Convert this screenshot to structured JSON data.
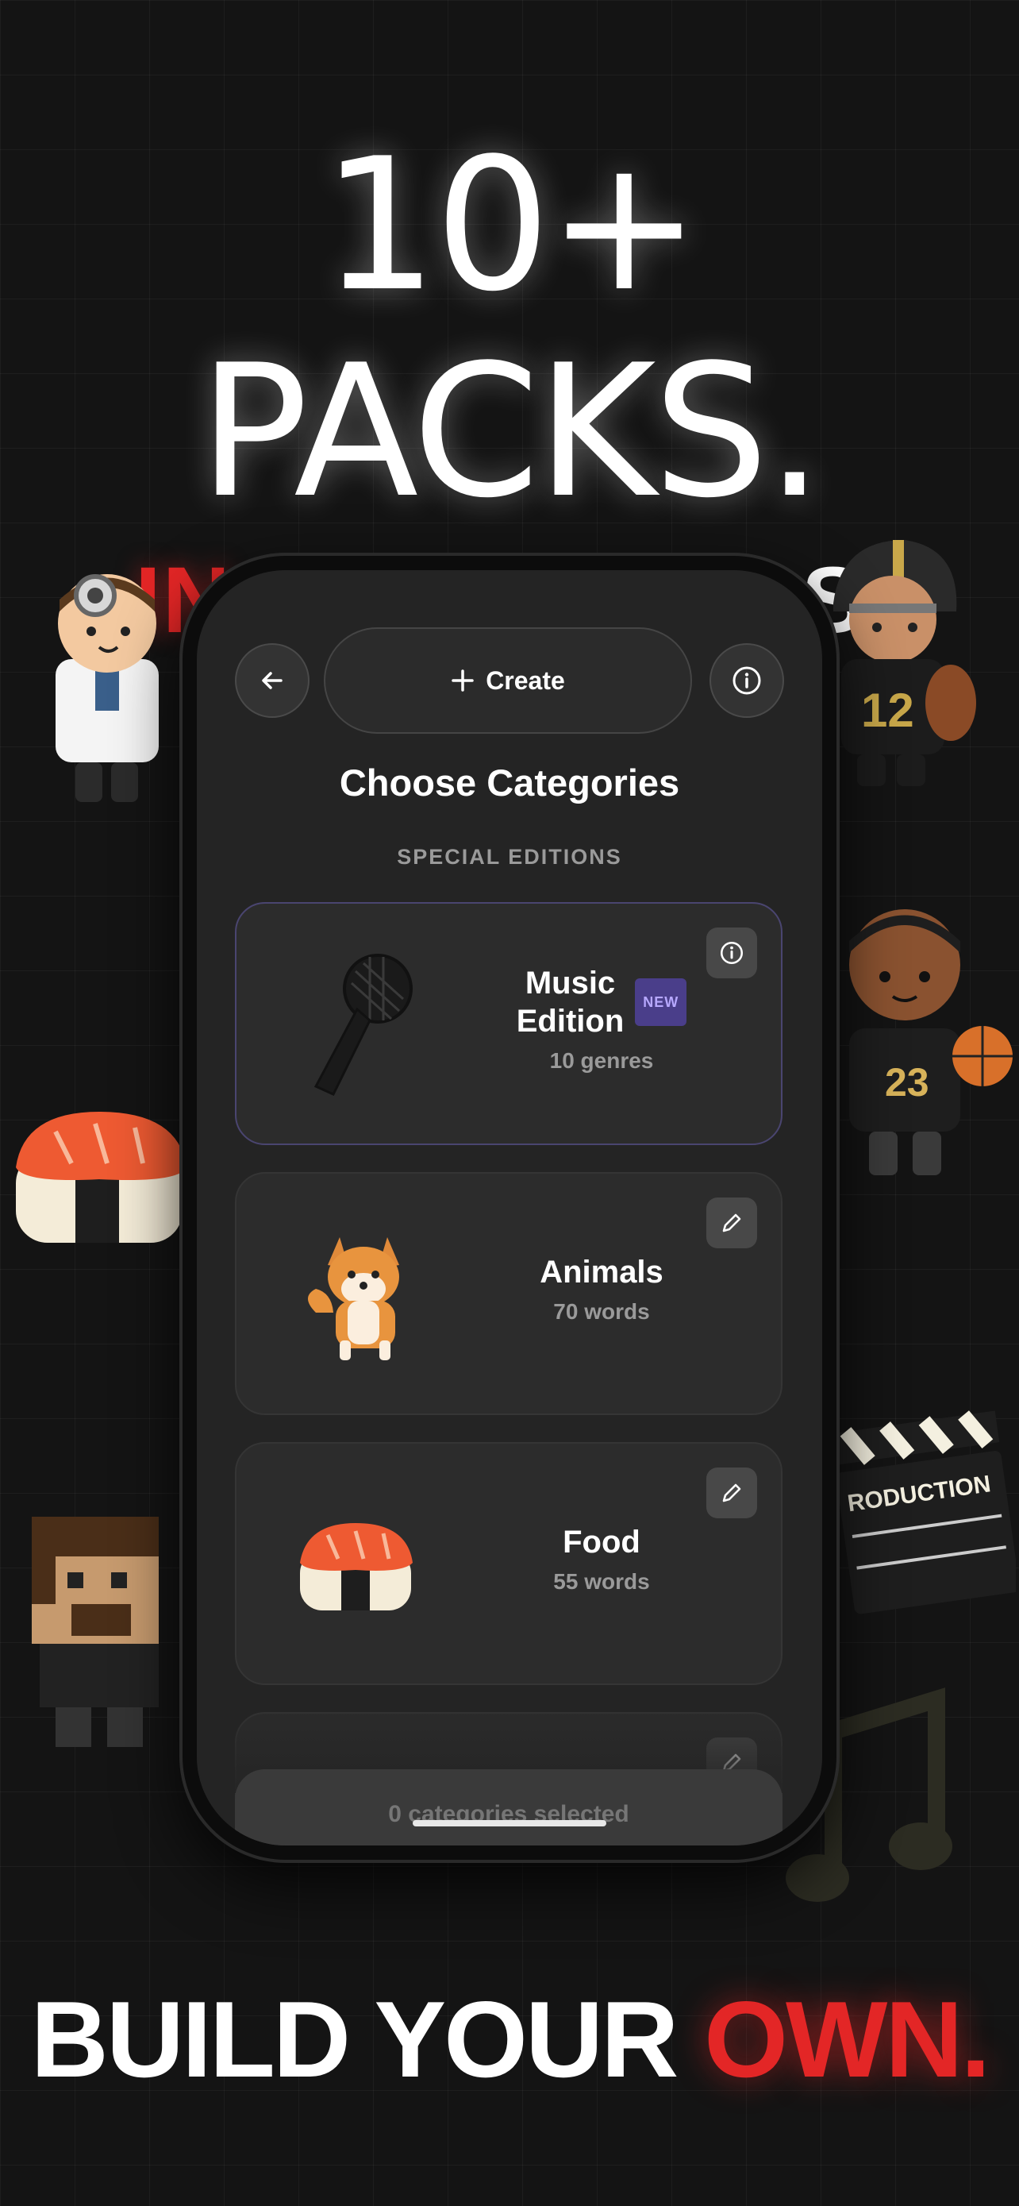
{
  "hero": {
    "line1": "10+",
    "line2": "PACKS.",
    "peek_left": "IN",
    "peek_right": "S."
  },
  "footer": {
    "part1": "BUILD YOUR ",
    "part2": "OWN."
  },
  "app": {
    "create_label": "Create",
    "title": "Choose Categories",
    "section_label": "SPECIAL EDITIONS",
    "cards": [
      {
        "name": "Music\nEdition",
        "name_line1": "Music",
        "name_line2": "Edition",
        "badge": "NEW",
        "sub": "10 genres",
        "corner_icon": "info-icon",
        "art_icon": "microphone-icon"
      },
      {
        "name": "Animals",
        "sub": "70 words",
        "corner_icon": "pencil-icon",
        "art_icon": "shiba-dog-icon"
      },
      {
        "name": "Food",
        "sub": "55 words",
        "corner_icon": "pencil-icon",
        "art_icon": "salmon-sushi-icon"
      },
      {
        "corner_icon": "pencil-icon"
      }
    ],
    "selected_status": "0 categories selected"
  },
  "colors": {
    "accent_red": "#e32626",
    "badge_purple": "#4a3e8a",
    "background": "#141414",
    "screen_bg": "#242424"
  }
}
